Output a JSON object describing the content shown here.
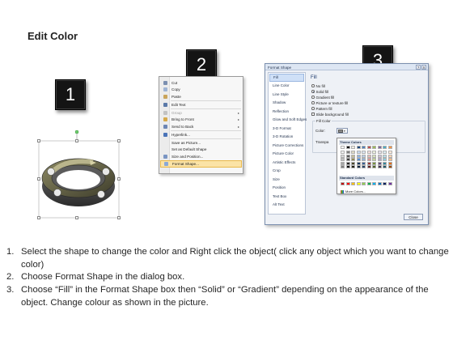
{
  "title": "Edit Color",
  "steps": [
    "1",
    "2",
    "3"
  ],
  "context_menu": {
    "items": [
      {
        "label": "Cut",
        "icon": "scissors-icon",
        "disabled": false,
        "submenu": false,
        "highlighted": false
      },
      {
        "label": "Copy",
        "icon": "copy-icon",
        "disabled": false,
        "submenu": false,
        "highlighted": false
      },
      {
        "label": "Paste",
        "icon": "paste-icon",
        "disabled": false,
        "submenu": false,
        "highlighted": false
      },
      {
        "label": "Edit Text",
        "icon": "edit-text-icon",
        "disabled": false,
        "submenu": false,
        "highlighted": false
      },
      {
        "label": "Group",
        "icon": "group-icon",
        "disabled": true,
        "submenu": true,
        "highlighted": false
      },
      {
        "label": "Bring to Front",
        "icon": "bring-front-icon",
        "disabled": false,
        "submenu": true,
        "highlighted": false
      },
      {
        "label": "Send to Back",
        "icon": "send-back-icon",
        "disabled": false,
        "submenu": true,
        "highlighted": false
      },
      {
        "label": "Hyperlink...",
        "icon": "hyperlink-icon",
        "disabled": false,
        "submenu": false,
        "highlighted": false
      },
      {
        "label": "Save as Picture...",
        "icon": "",
        "disabled": false,
        "submenu": false,
        "highlighted": false
      },
      {
        "label": "Set as Default Shape",
        "icon": "",
        "disabled": false,
        "submenu": false,
        "highlighted": false
      },
      {
        "label": "Size and Position...",
        "icon": "size-position-icon",
        "disabled": false,
        "submenu": false,
        "highlighted": false
      },
      {
        "label": "Format Shape...",
        "icon": "format-shape-icon",
        "disabled": false,
        "submenu": false,
        "highlighted": true
      }
    ]
  },
  "dialog": {
    "title": "Format Shape",
    "help": "?",
    "close_glyph": "X",
    "nav": [
      "Fill",
      "Line Color",
      "Line Style",
      "Shadow",
      "Reflection",
      "Glow and Soft Edges",
      "3-D Format",
      "3-D Rotation",
      "Picture Corrections",
      "Picture Color",
      "Artistic Effects",
      "Crop",
      "Size",
      "Position",
      "Text Box",
      "Alt Text"
    ],
    "nav_selected": "Fill",
    "pane_heading": "Fill",
    "fill_options": [
      {
        "label": "No fill",
        "selected": false,
        "kind": "radio"
      },
      {
        "label": "Solid fill",
        "selected": true,
        "kind": "radio"
      },
      {
        "label": "Gradient fill",
        "selected": false,
        "kind": "radio"
      },
      {
        "label": "Picture or texture fill",
        "selected": false,
        "kind": "radio"
      },
      {
        "label": "Pattern fill",
        "selected": false,
        "kind": "radio"
      },
      {
        "label": "Slide background fill",
        "selected": false,
        "kind": "checkbox"
      }
    ],
    "group_label": "Fill Color",
    "color_label": "Color:",
    "transparency_label": "Transpa",
    "close_button": "Close"
  },
  "palette": {
    "theme_heading": "Theme Colors",
    "standard_heading": "Standard Colors",
    "more_colors": "More Colors...",
    "theme_top": [
      "#ffffff",
      "#000000",
      "#eeece1",
      "#1f497d",
      "#4f81bd",
      "#c0504d",
      "#9bbb59",
      "#8064a2",
      "#4bacc6",
      "#f79646"
    ],
    "theme_shades": [
      [
        "#f2f2f2",
        "#7f7f7f",
        "#ddd9c3",
        "#c6d9f0",
        "#dbe5f1",
        "#f2dcdb",
        "#ebf1dd",
        "#e5e0ec",
        "#dbeef3",
        "#fdeada"
      ],
      [
        "#d8d8d8",
        "#595959",
        "#c4bd97",
        "#8db3e2",
        "#b8cce4",
        "#e5b9b7",
        "#d7e3bc",
        "#ccc1d9",
        "#b7dde8",
        "#fbd5b5"
      ],
      [
        "#bfbfbf",
        "#3f3f3f",
        "#938953",
        "#548dd4",
        "#95b3d7",
        "#d99694",
        "#c3d69b",
        "#b2a2c7",
        "#92cddc",
        "#fac08f"
      ],
      [
        "#a5a5a5",
        "#262626",
        "#494429",
        "#17365d",
        "#366092",
        "#953734",
        "#76923c",
        "#5f497a",
        "#31859b",
        "#e36c09"
      ],
      [
        "#7f7f7f",
        "#0c0c0c",
        "#1d1b10",
        "#0f243e",
        "#244061",
        "#632423",
        "#4f6128",
        "#3f3151",
        "#205867",
        "#974806"
      ]
    ],
    "standard": [
      "#c00000",
      "#ff0000",
      "#ffc000",
      "#ffff00",
      "#92d050",
      "#00b050",
      "#00b0f0",
      "#0070c0",
      "#002060",
      "#7030a0"
    ]
  },
  "instructions": [
    {
      "num": "1.",
      "text": "Select the shape to change the color and Right click the object( click any object which you want to change color)"
    },
    {
      "num": "2.",
      "text": "Choose Format Shape in the dialog box."
    },
    {
      "num": "3.",
      "text": "Choose “Fill” in the Format Shape box then “Solid” or “Gradient” depending on the appearance of the object. Change colour as shown in the picture."
    }
  ]
}
